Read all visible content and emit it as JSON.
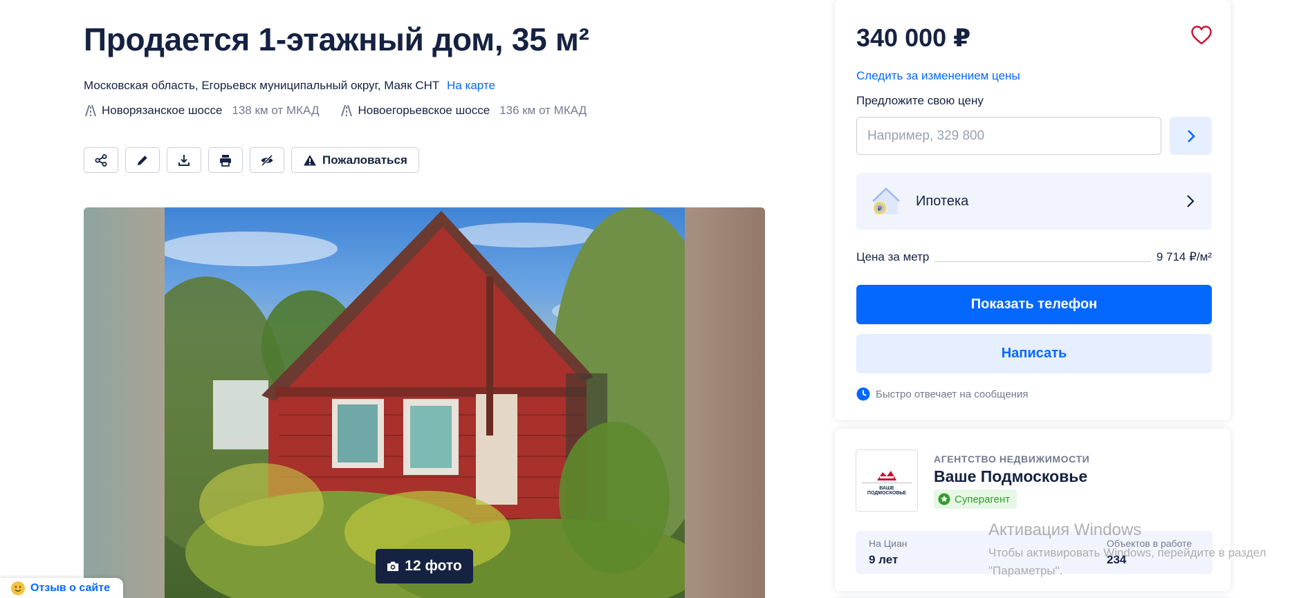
{
  "listing": {
    "title": "Продается 1-этажный дом, 35 м²",
    "address": "Московская область, Егорьевск муниципальный округ, Маяк СНТ",
    "map_link": "На карте",
    "highways": [
      {
        "name": "Новорязанское шоссе",
        "distance": "138 км от МКАД"
      },
      {
        "name": "Новоегорьевское шоссе",
        "distance": "136 км от МКАД"
      }
    ]
  },
  "actions": {
    "icons": [
      "share-icon",
      "edit-icon",
      "download-icon",
      "print-icon",
      "hide-icon"
    ],
    "report_label": "Пожаловаться"
  },
  "gallery": {
    "photo_count_label": "12 фото"
  },
  "price_card": {
    "price": "340 000 ₽",
    "follow_price": "Следить за изменением цены",
    "offer_label": "Предложите свою цену",
    "offer_placeholder": "Например, 329 800",
    "mortgage_label": "Ипотека",
    "price_per_meter_label": "Цена за метр",
    "price_per_meter_value": "9 714 ₽/м²",
    "show_phone": "Показать телефон",
    "write": "Написать",
    "fast_reply": "Быстро отвечает на сообщения"
  },
  "agency": {
    "type": "АГЕНТСТВО НЕДВИЖИМОСТИ",
    "name": "Ваше Подмосковье",
    "badge": "Суперагент",
    "logo_text": "ВАШЕ ПОДМОСКОВЬЕ",
    "stats": [
      {
        "label": "На Циан",
        "value": "9 лет"
      },
      {
        "label": "Объектов в работе",
        "value": "234"
      }
    ]
  },
  "feedback": {
    "label": "Отзыв о сайте"
  },
  "watermark": {
    "line1": "Активация Windows",
    "line2": "Чтобы активировать Windows, перейдите в раздел",
    "line3": "\"Параметры\"."
  },
  "colors": {
    "accent": "#0468ff",
    "text": "#152242",
    "muted": "#737a8e",
    "light_accent": "#e6efff",
    "success": "#2f9e2a"
  }
}
